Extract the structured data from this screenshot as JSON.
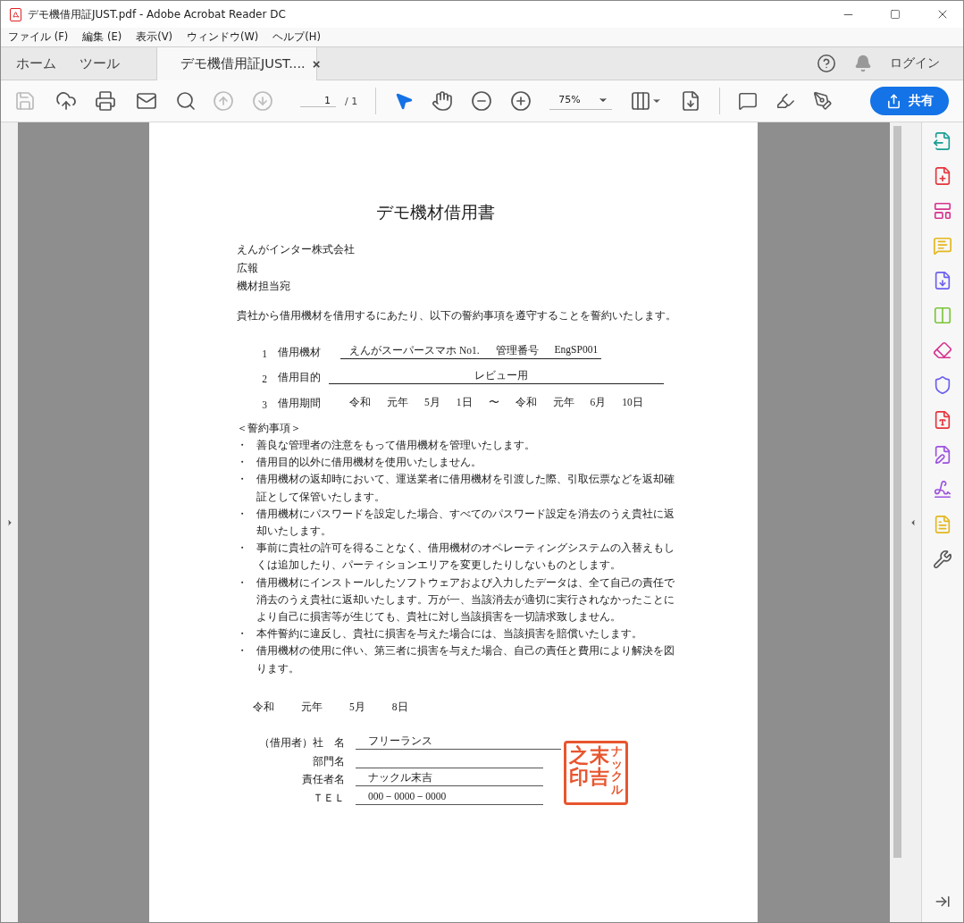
{
  "window": {
    "title": "デモ機借用証JUST.pdf - Adobe Acrobat Reader DC"
  },
  "menu": [
    "ファイル (F)",
    "編集 (E)",
    "表示(V)",
    "ウィンドウ(W)",
    "ヘルプ(H)"
  ],
  "tabs": [
    {
      "label": "ホーム",
      "selected": false,
      "kind": "nav"
    },
    {
      "label": "ツール",
      "selected": false,
      "kind": "nav"
    },
    {
      "label": "デモ機借用証JUST....",
      "selected": true,
      "kind": "document",
      "close": "×"
    }
  ],
  "login": "ログイン",
  "toolbar": {
    "page_current": "1",
    "page_total": "/ 1",
    "zoom": "75%",
    "share": "共有"
  },
  "document": {
    "title": "デモ機材借用書",
    "addressee": [
      "えんがインター株式会社",
      "広報",
      "機材担当宛"
    ],
    "intro": "貴社から借用機材を借用するにあたり、以下の誓約事項を遵守することを誓約いたします。",
    "items": [
      {
        "number": "1",
        "label": "借用機材",
        "underlined": true,
        "parts": [
          "えんがスーパースマホ No1.",
          "管理番号",
          "EngSP001"
        ]
      },
      {
        "number": "2",
        "label": "借用目的",
        "underlined": true,
        "parts": [
          "レビュー用"
        ]
      },
      {
        "number": "3",
        "label": "借用期間",
        "underlined": false,
        "parts": [
          "令和",
          "元年",
          "5月",
          "1日",
          "〜",
          "令和",
          "元年",
          "6月",
          "10日"
        ]
      }
    ],
    "pledge_heading": "＜誓約事項＞",
    "pledges": [
      {
        "bullet": "・",
        "text": "善良な管理者の注意をもって借用機材を管理いたします。"
      },
      {
        "bullet": "・",
        "text": "借用目的以外に借用機材を使用いたしません。"
      },
      {
        "bullet": "・",
        "text": "借用機材の返却時において、運送業者に借用機材を引渡した際、引取伝票などを返却確証として保管いたします。"
      },
      {
        "bullet": "・",
        "text": "借用機材にパスワードを設定した場合、すべてのパスワード設定を消去のうえ貴社に返却いたします。"
      },
      {
        "bullet": "・",
        "text": "事前に貴社の許可を得ることなく、借用機材のオペレーティングシステムの入替えもしくは追加したり、パーティションエリアを変更したりしないものとします。"
      },
      {
        "bullet": "・",
        "text": "借用機材にインストールしたソフトウェアおよび入力したデータは、全て自己の責任で消去のうえ貴社に返却いたします。万が一、当該消去が適切に実行されなかったことにより自己に損害等が生じても、貴社に対し当該損害を一切請求致しません。"
      },
      {
        "bullet": "・",
        "text": "本件誓約に違反し、貴社に損害を与えた場合には、当該損害を賠償いたします。"
      },
      {
        "bullet": "・",
        "text": "借用機材の使用に伴い、第三者に損害を与えた場合、自己の責任と費用により解決を図ります。"
      }
    ],
    "date": [
      "令和",
      "元年",
      "5月",
      "8日"
    ],
    "signer": [
      {
        "label": "（借用者）社　名",
        "value": "フリーランス"
      },
      {
        "label": "部門名"
      },
      {
        "label": "責任者名",
        "value": "ナックル末吉"
      },
      {
        "label": "ＴＥＬ",
        "value": "000－0000－0000"
      }
    ],
    "stamp": [
      "之印",
      "末吉",
      "ナックル"
    ]
  }
}
